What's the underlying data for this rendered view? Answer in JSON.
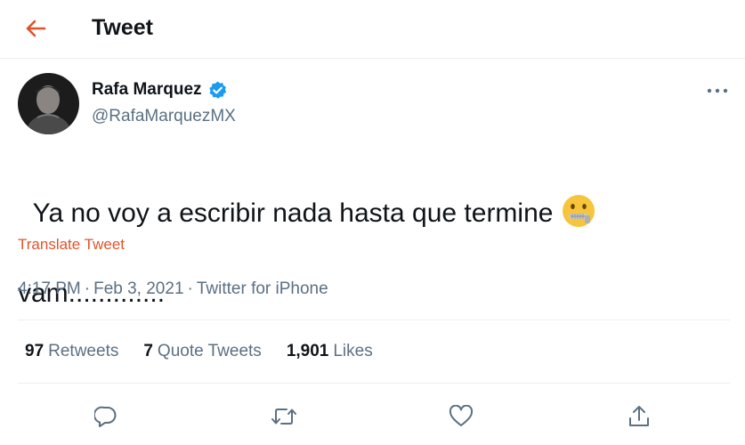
{
  "header": {
    "title": "Tweet",
    "back_icon": "arrow-left-icon",
    "accent_color": "#e0542a"
  },
  "tweet": {
    "author": {
      "display_name": "Rafa Marquez",
      "handle": "@RafaMarquezMX",
      "verified": true,
      "verified_icon": "verified-badge-icon"
    },
    "text_line1": "Ya no voy a escribir nada hasta que termine",
    "text_line2": "vam.............",
    "emoji_icon": "zipper-mouth-face-icon",
    "translate_label": "Translate Tweet",
    "time": "4:17 PM",
    "date": "Feb 3, 2021",
    "source": "Twitter for iPhone",
    "separator": "·"
  },
  "stats": [
    {
      "count": "97",
      "label": "Retweets"
    },
    {
      "count": "7",
      "label": "Quote Tweets"
    },
    {
      "count": "1,901",
      "label": "Likes"
    }
  ],
  "actions": {
    "reply_icon": "reply-icon",
    "retweet_icon": "retweet-icon",
    "like_icon": "heart-icon",
    "share_icon": "share-icon"
  },
  "colors": {
    "text": "#0f1419",
    "secondary": "#5b7083",
    "verified": "#1d9bf0",
    "divider": "#ebeef0"
  }
}
